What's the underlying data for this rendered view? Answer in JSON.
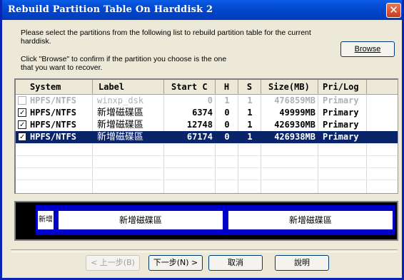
{
  "window": {
    "title": "Rebuild Partition Table On Harddisk 2",
    "close_glyph": "✕"
  },
  "instructions": {
    "line1": "Please select the partitions from the following list to rebuild partition table for the current",
    "line2": "harddisk.",
    "line3": "Click \"Browse\" to confirm if the partition you choose is the one",
    "line4": "that you want to recover."
  },
  "browse_button": {
    "label": "Browse"
  },
  "partition_list": {
    "columns": [
      "System",
      "Label",
      "Start C",
      "H",
      "S",
      "Size(MB)",
      "Pri/Log"
    ],
    "rows": [
      {
        "checked": false,
        "system": "HPFS/NTFS",
        "label": "winxp_dsk",
        "start_c": "0",
        "h": "1",
        "s": "1",
        "size_mb": "476859MB",
        "pri_log": "Primary",
        "state": "disabled"
      },
      {
        "checked": true,
        "system": "HPFS/NTFS",
        "label": "新增磁碟區",
        "start_c": "6374",
        "h": "0",
        "s": "1",
        "size_mb": "49999MB",
        "pri_log": "Primary",
        "state": "normal"
      },
      {
        "checked": true,
        "system": "HPFS/NTFS",
        "label": "新增磁碟區",
        "start_c": "12748",
        "h": "0",
        "s": "1",
        "size_mb": "426930MB",
        "pri_log": "Primary",
        "state": "normal"
      },
      {
        "checked": true,
        "system": "HPFS/NTFS",
        "label": "新增磁碟區",
        "start_c": "67174",
        "h": "0",
        "s": "1",
        "size_mb": "426938MB",
        "pri_log": "Primary",
        "state": "selected"
      }
    ]
  },
  "disk_map": {
    "segments": [
      {
        "label": "新增磁碟區"
      },
      {
        "label": "新增磁碟區"
      },
      {
        "label": "新增磁碟區"
      }
    ]
  },
  "buttons": {
    "back": "< 上一步(B)",
    "next": "下一步(N) >",
    "cancel": "取消",
    "help": "說明"
  },
  "colors": {
    "titlebar": "#0044c8",
    "selection": "#0a246a",
    "map_partition": "#0000cc",
    "window_bg": "#ece9d8"
  }
}
